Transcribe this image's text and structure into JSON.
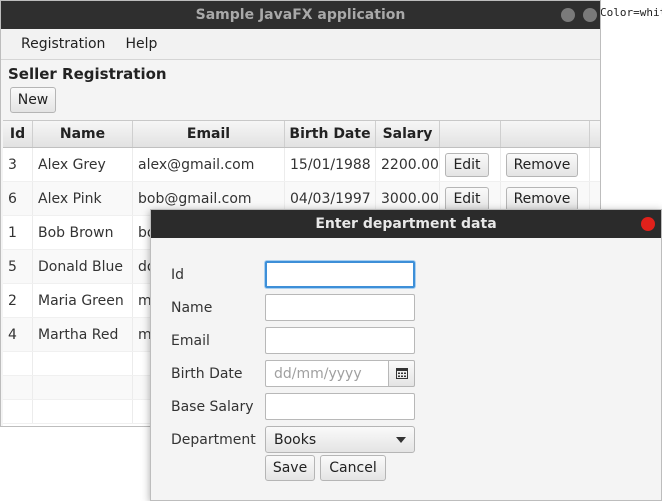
{
  "background_text": "Color=whit",
  "main_window": {
    "title": "Sample JavaFX application",
    "menu": [
      "Registration",
      "Help"
    ],
    "heading": "Seller Registration",
    "new_label": "New",
    "columns": [
      "Id",
      "Name",
      "Email",
      "Birth Date",
      "Salary"
    ],
    "rows": [
      {
        "id": "3",
        "name": "Alex Grey",
        "email": "alex@gmail.com",
        "birth": "15/01/1988",
        "salary": "2200.00"
      },
      {
        "id": "6",
        "name": "Alex Pink",
        "email": "bob@gmail.com",
        "birth": "04/03/1997",
        "salary": "3000.00"
      },
      {
        "id": "1",
        "name": "Bob Brown",
        "email": "bo",
        "birth": "",
        "salary": ""
      },
      {
        "id": "5",
        "name": "Donald Blue",
        "email": "do",
        "birth": "",
        "salary": ""
      },
      {
        "id": "2",
        "name": "Maria Green",
        "email": "m",
        "birth": "",
        "salary": ""
      },
      {
        "id": "4",
        "name": "Martha Red",
        "email": "m",
        "birth": "",
        "salary": ""
      }
    ],
    "edit_label": "Edit",
    "remove_label": "Remove"
  },
  "dialog": {
    "title": "Enter department data",
    "labels": {
      "id": "Id",
      "name": "Name",
      "email": "Email",
      "birth_date": "Birth Date",
      "base_salary": "Base Salary",
      "department": "Department"
    },
    "birth_placeholder": "dd/mm/yyyy",
    "department_value": "Books",
    "save_label": "Save",
    "cancel_label": "Cancel"
  },
  "colors": {
    "title_bar": "#2f2f2f",
    "focus": "#3d8fd8",
    "close_button": "#e0211b"
  }
}
